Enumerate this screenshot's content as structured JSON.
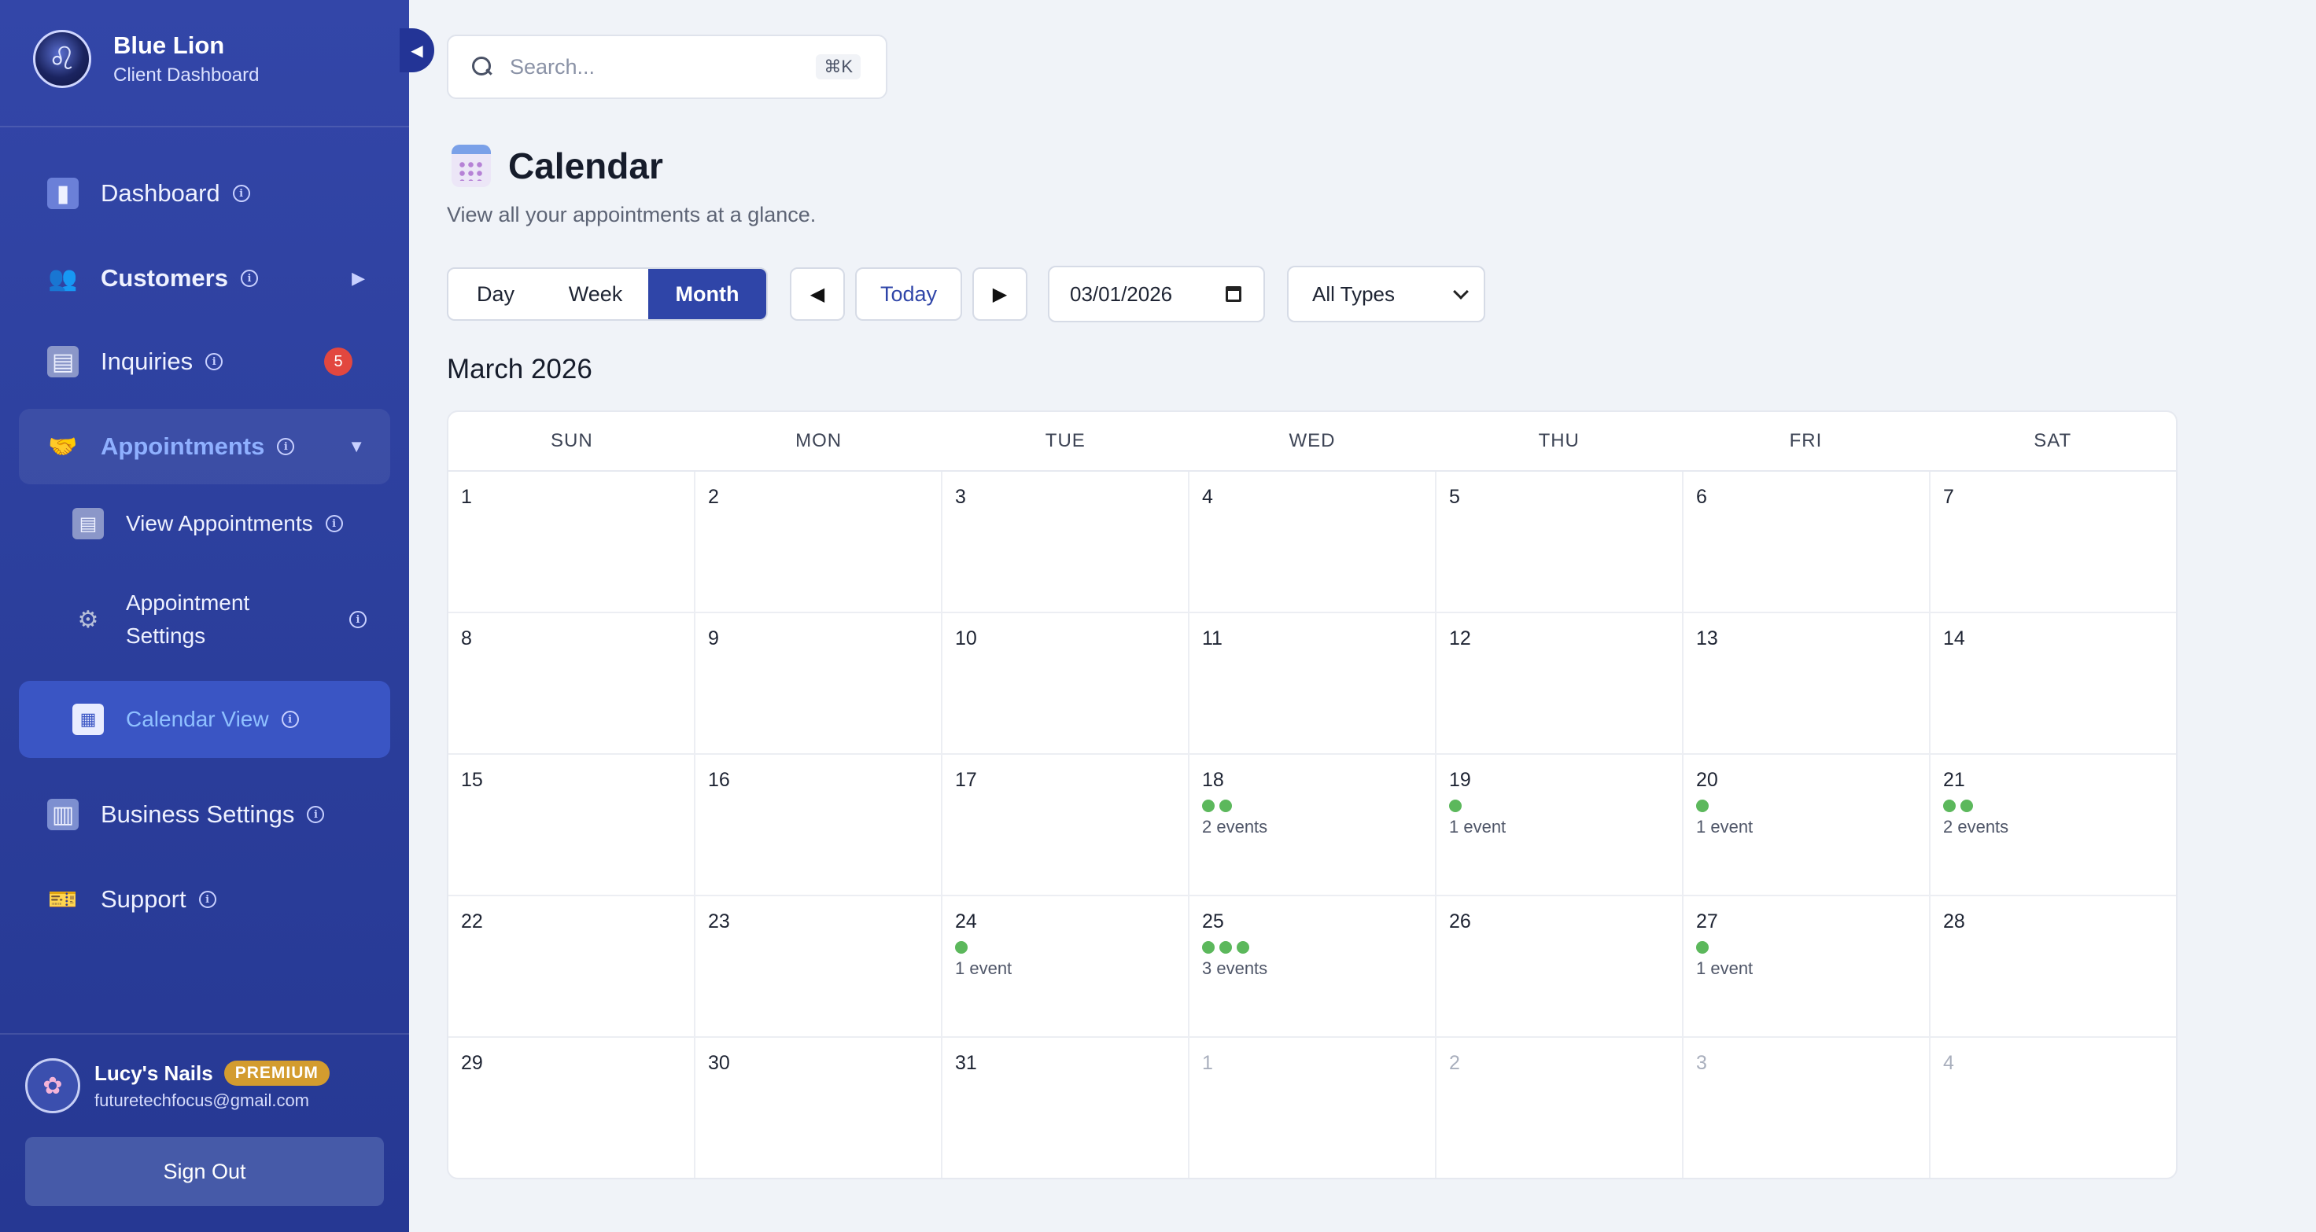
{
  "brand": {
    "name": "Blue Lion",
    "subtitle": "Client Dashboard"
  },
  "sidebar": {
    "items": [
      {
        "label": "Dashboard",
        "icon": "chart-icon"
      },
      {
        "label": "Customers",
        "icon": "people-icon"
      },
      {
        "label": "Inquiries",
        "icon": "clipboard-icon",
        "badge": "5"
      },
      {
        "label": "Appointments",
        "icon": "handshake-icon"
      },
      {
        "label": "View Appointments",
        "icon": "clipboard-icon"
      },
      {
        "label": "Appointment Settings",
        "icon": "gear-icon"
      },
      {
        "label": "Calendar View",
        "icon": "calendar-icon"
      },
      {
        "label": "Business Settings",
        "icon": "building-icon"
      },
      {
        "label": "Support",
        "icon": "ticket-icon"
      }
    ]
  },
  "user": {
    "name": "Lucy's Nails",
    "tier": "PREMIUM",
    "email": "futuretechfocus@gmail.com",
    "signout_label": "Sign Out"
  },
  "search": {
    "placeholder": "Search...",
    "shortcut": "⌘K"
  },
  "page": {
    "title": "Calendar",
    "subtitle": "View all your appointments at a glance."
  },
  "toolbar": {
    "views": [
      "Day",
      "Week",
      "Month"
    ],
    "active_view": "Month",
    "prev": "◀",
    "today": "Today",
    "next": "▶",
    "date_value": "03/01/2026",
    "type_filter": "All Types"
  },
  "calendar": {
    "month_label": "March 2026",
    "weekdays": [
      "SUN",
      "MON",
      "TUE",
      "WED",
      "THU",
      "FRI",
      "SAT"
    ],
    "weeks": [
      [
        {
          "d": "1"
        },
        {
          "d": "2"
        },
        {
          "d": "3"
        },
        {
          "d": "4"
        },
        {
          "d": "5"
        },
        {
          "d": "6"
        },
        {
          "d": "7"
        }
      ],
      [
        {
          "d": "8"
        },
        {
          "d": "9"
        },
        {
          "d": "10"
        },
        {
          "d": "11"
        },
        {
          "d": "12"
        },
        {
          "d": "13"
        },
        {
          "d": "14"
        }
      ],
      [
        {
          "d": "15"
        },
        {
          "d": "16"
        },
        {
          "d": "17"
        },
        {
          "d": "18",
          "events": 2,
          "label": "2 events"
        },
        {
          "d": "19",
          "events": 1,
          "label": "1 event"
        },
        {
          "d": "20",
          "events": 1,
          "label": "1 event"
        },
        {
          "d": "21",
          "events": 2,
          "label": "2 events"
        }
      ],
      [
        {
          "d": "22"
        },
        {
          "d": "23"
        },
        {
          "d": "24",
          "events": 1,
          "label": "1 event"
        },
        {
          "d": "25",
          "events": 3,
          "label": "3 events"
        },
        {
          "d": "26"
        },
        {
          "d": "27",
          "events": 1,
          "label": "1 event"
        },
        {
          "d": "28"
        }
      ],
      [
        {
          "d": "29"
        },
        {
          "d": "30"
        },
        {
          "d": "31"
        },
        {
          "d": "1",
          "out": true
        },
        {
          "d": "2",
          "out": true
        },
        {
          "d": "3",
          "out": true
        },
        {
          "d": "4",
          "out": true
        }
      ]
    ]
  },
  "colors": {
    "sidebar": "#2f43a4",
    "accent": "#2f45a8",
    "event_dot": "#5cb85c",
    "badge": "#e2473f",
    "premium": "#d39c2f"
  }
}
